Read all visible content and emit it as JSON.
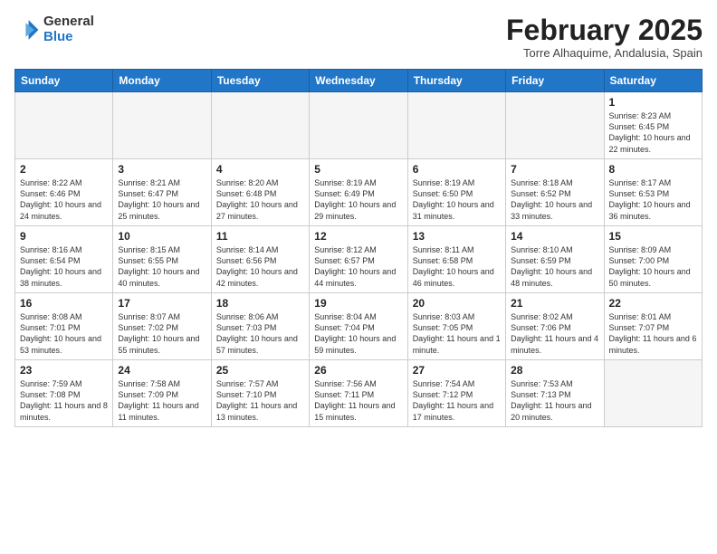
{
  "header": {
    "logo_general": "General",
    "logo_blue": "Blue",
    "month_title": "February 2025",
    "subtitle": "Torre Alhaquime, Andalusia, Spain"
  },
  "days_of_week": [
    "Sunday",
    "Monday",
    "Tuesday",
    "Wednesday",
    "Thursday",
    "Friday",
    "Saturday"
  ],
  "weeks": [
    [
      {
        "day": "",
        "info": ""
      },
      {
        "day": "",
        "info": ""
      },
      {
        "day": "",
        "info": ""
      },
      {
        "day": "",
        "info": ""
      },
      {
        "day": "",
        "info": ""
      },
      {
        "day": "",
        "info": ""
      },
      {
        "day": "1",
        "info": "Sunrise: 8:23 AM\nSunset: 6:45 PM\nDaylight: 10 hours and 22 minutes."
      }
    ],
    [
      {
        "day": "2",
        "info": "Sunrise: 8:22 AM\nSunset: 6:46 PM\nDaylight: 10 hours and 24 minutes."
      },
      {
        "day": "3",
        "info": "Sunrise: 8:21 AM\nSunset: 6:47 PM\nDaylight: 10 hours and 25 minutes."
      },
      {
        "day": "4",
        "info": "Sunrise: 8:20 AM\nSunset: 6:48 PM\nDaylight: 10 hours and 27 minutes."
      },
      {
        "day": "5",
        "info": "Sunrise: 8:19 AM\nSunset: 6:49 PM\nDaylight: 10 hours and 29 minutes."
      },
      {
        "day": "6",
        "info": "Sunrise: 8:19 AM\nSunset: 6:50 PM\nDaylight: 10 hours and 31 minutes."
      },
      {
        "day": "7",
        "info": "Sunrise: 8:18 AM\nSunset: 6:52 PM\nDaylight: 10 hours and 33 minutes."
      },
      {
        "day": "8",
        "info": "Sunrise: 8:17 AM\nSunset: 6:53 PM\nDaylight: 10 hours and 36 minutes."
      }
    ],
    [
      {
        "day": "9",
        "info": "Sunrise: 8:16 AM\nSunset: 6:54 PM\nDaylight: 10 hours and 38 minutes."
      },
      {
        "day": "10",
        "info": "Sunrise: 8:15 AM\nSunset: 6:55 PM\nDaylight: 10 hours and 40 minutes."
      },
      {
        "day": "11",
        "info": "Sunrise: 8:14 AM\nSunset: 6:56 PM\nDaylight: 10 hours and 42 minutes."
      },
      {
        "day": "12",
        "info": "Sunrise: 8:12 AM\nSunset: 6:57 PM\nDaylight: 10 hours and 44 minutes."
      },
      {
        "day": "13",
        "info": "Sunrise: 8:11 AM\nSunset: 6:58 PM\nDaylight: 10 hours and 46 minutes."
      },
      {
        "day": "14",
        "info": "Sunrise: 8:10 AM\nSunset: 6:59 PM\nDaylight: 10 hours and 48 minutes."
      },
      {
        "day": "15",
        "info": "Sunrise: 8:09 AM\nSunset: 7:00 PM\nDaylight: 10 hours and 50 minutes."
      }
    ],
    [
      {
        "day": "16",
        "info": "Sunrise: 8:08 AM\nSunset: 7:01 PM\nDaylight: 10 hours and 53 minutes."
      },
      {
        "day": "17",
        "info": "Sunrise: 8:07 AM\nSunset: 7:02 PM\nDaylight: 10 hours and 55 minutes."
      },
      {
        "day": "18",
        "info": "Sunrise: 8:06 AM\nSunset: 7:03 PM\nDaylight: 10 hours and 57 minutes."
      },
      {
        "day": "19",
        "info": "Sunrise: 8:04 AM\nSunset: 7:04 PM\nDaylight: 10 hours and 59 minutes."
      },
      {
        "day": "20",
        "info": "Sunrise: 8:03 AM\nSunset: 7:05 PM\nDaylight: 11 hours and 1 minute."
      },
      {
        "day": "21",
        "info": "Sunrise: 8:02 AM\nSunset: 7:06 PM\nDaylight: 11 hours and 4 minutes."
      },
      {
        "day": "22",
        "info": "Sunrise: 8:01 AM\nSunset: 7:07 PM\nDaylight: 11 hours and 6 minutes."
      }
    ],
    [
      {
        "day": "23",
        "info": "Sunrise: 7:59 AM\nSunset: 7:08 PM\nDaylight: 11 hours and 8 minutes."
      },
      {
        "day": "24",
        "info": "Sunrise: 7:58 AM\nSunset: 7:09 PM\nDaylight: 11 hours and 11 minutes."
      },
      {
        "day": "25",
        "info": "Sunrise: 7:57 AM\nSunset: 7:10 PM\nDaylight: 11 hours and 13 minutes."
      },
      {
        "day": "26",
        "info": "Sunrise: 7:56 AM\nSunset: 7:11 PM\nDaylight: 11 hours and 15 minutes."
      },
      {
        "day": "27",
        "info": "Sunrise: 7:54 AM\nSunset: 7:12 PM\nDaylight: 11 hours and 17 minutes."
      },
      {
        "day": "28",
        "info": "Sunrise: 7:53 AM\nSunset: 7:13 PM\nDaylight: 11 hours and 20 minutes."
      },
      {
        "day": "",
        "info": ""
      }
    ]
  ]
}
